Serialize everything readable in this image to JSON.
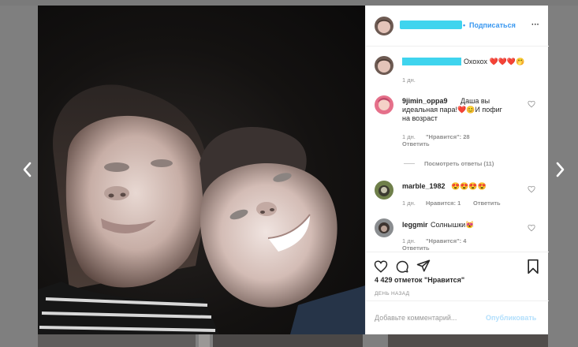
{
  "header": {
    "follow_dot": "•",
    "follow_label": "Подписаться",
    "more_label": "···"
  },
  "caption": {
    "text": "Охохох ❤️❤️❤️🤭",
    "time": "1 дн."
  },
  "comments": [
    {
      "username": "9jimin_oppa9",
      "text_line1": "Даша вы",
      "text_line2": "идеальная пара!❤️😊И пофиг",
      "text_line3": "на возраст",
      "time": "1 дн.",
      "likes": "\"Нравится\": 28",
      "reply": "Ответить",
      "view_replies": "Посмотреть ответы (11)"
    },
    {
      "username": "marble_1982",
      "text": "😍😍😍😍",
      "time": "1 дн.",
      "likes": "Нравится: 1",
      "reply": "Ответить"
    },
    {
      "username": "leggmir",
      "text": "Солнышки😻",
      "time": "1 дн.",
      "likes": "\"Нравится\": 4",
      "reply": "Ответить"
    }
  ],
  "stats": {
    "likes": "4 429 отметок \"Нравится\"",
    "date": "ДЕНЬ НАЗАД"
  },
  "composer": {
    "placeholder": "Добавьте комментарий...",
    "publish": "Опубликовать"
  },
  "colors": {
    "accent": "#3897f0",
    "redaction": "#3fd4ee"
  },
  "icons": [
    "chevron-left-icon",
    "chevron-right-icon",
    "heart-icon",
    "comment-icon",
    "share-icon",
    "bookmark-icon",
    "more-icon"
  ]
}
